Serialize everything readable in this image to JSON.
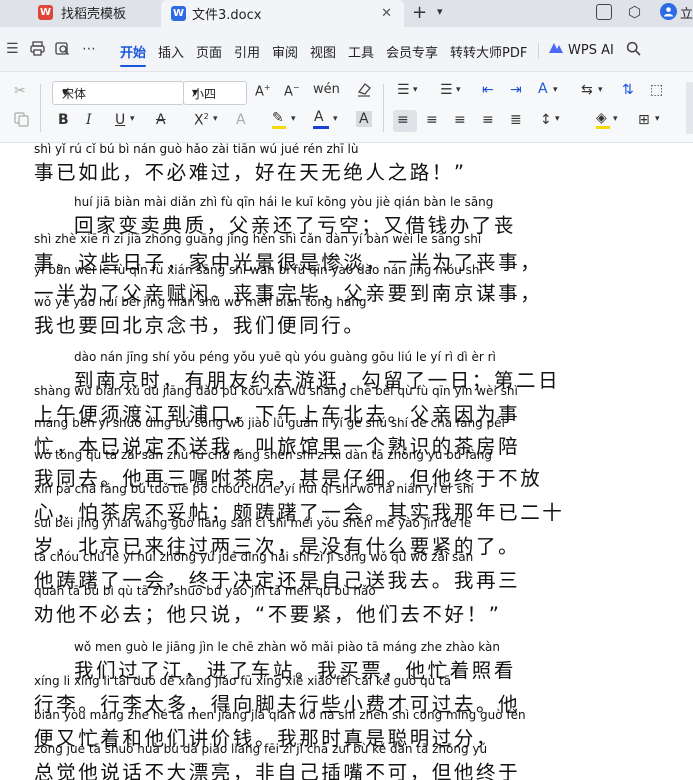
{
  "tabs": [
    {
      "label": "找稻壳模板"
    },
    {
      "label": "文件3.docx"
    }
  ],
  "tab_icons": {
    "wps": "W",
    "doc": "W"
  },
  "user": {
    "initial": "立",
    "name": "立"
  },
  "menu": {
    "items": [
      "开始",
      "插入",
      "页面",
      "引用",
      "审阅",
      "视图",
      "工具",
      "会员专享",
      "转转大师PDF"
    ],
    "wps_ai": "WPS AI"
  },
  "ribbon": {
    "font_name": "宋体",
    "font_size": "小四"
  },
  "document": {
    "lines": [
      {
        "py": "shì  yǐ  rú  cǐ    bú  bì  nán  guò     hǎo  zài  tiān  wú  jué  rén  zhī  lù",
        "hz": "事已如此，不必难过，好在天无绝人之路！”"
      },
      {
        "py": "huí  jiā  biàn  mài  diǎn  zhì    fù  qīn  hái  le  kuī  kōng    yòu  jiè  qián  bàn  le  sāng",
        "hz": "回家变卖典质，父亲还了亏空；又借钱办了丧",
        "indent": true
      },
      {
        "py": "shì    zhè  xiē  rì  zi     jiā  zhōng  guāng  jǐng  hěn  shì  cǎn  dàn     yí  bàn  wèi  le  sāng  shì",
        "hz": "事。这些日子，家中光景很是惨淡，一半为了丧事，"
      },
      {
        "py": "yí  bàn  wèi  le  fù  qīn  fù  xián    sāng  shì  wán  bì     fù  qīn  yào  dào  nán  jīng  móu  shì",
        "hz": "一半为了父亲赋闲。丧事完毕，父亲要到南京谋事，"
      },
      {
        "py": "wǒ  yě  yào  huí  běi  jīng  niàn  shū     wǒ  men  biàn  tóng  háng",
        "hz": "我也要回北京念书，我们便同行。"
      },
      {
        "py": "dào  nán  jīng  shí     yǒu  péng  yǒu  yuē  qù  yóu  guàng     gōu  liú  le  yí  rì     dì  èr  rì",
        "hz": "到南京时，有朋友约去游逛，勾留了一日；第二日",
        "indent": true
      },
      {
        "py": "shàng  wǔ  biàn  xū  dù  jiāng  dào  pǔ  kǒu     xià  wǔ  shàng  chē  běi  qù     fù  qīn  yīn  wèi  shì",
        "hz": "上午便须渡江到浦口，下午上车北去。父亲因为事"
      },
      {
        "py": "máng    běn  yǐ  shuō  dìng  bú  sòng  wǒ     jiào  lǚ  guǎn  lǐ  yí  gè  shú  shí  de  chá  fáng  péi",
        "hz": "忙，本已说定不送我，叫旅馆里一个熟识的茶房陪"
      },
      {
        "py": "wǒ  tóng  qù     tā  zài  sān  zhǔ  fù  chá  fáng     shèn  shì  zǐ  xì     dàn  tā  zhōng  yú  bú  fàng",
        "hz": "我同去。他再三嘱咐茶房，甚是仔细。但他终于不放"
      },
      {
        "py": "xīn     pà  chá  fáng  bú  tuǒ  tiē     pō  chóu  chú  le  yí  huì     qí  shí  wǒ  nà  nián  yǐ  èr  shí",
        "hz": "心，怕茶房不妥帖；颇踌躇了一会。其实我那年已二十"
      },
      {
        "py": "suì    běi  jīng  yǐ  lái  wǎng  guò  liǎng  sān  cì     shì  méi  yǒu  shén  me  yào  jǐn  de  le",
        "hz": "岁，北京已来往过两三次，是没有什么要紧的了。"
      },
      {
        "py": "tā  chóu  chú  le  yí  huì     zhōng  yú  jué  dìng  hái  shi  zì  jǐ  sòng  wǒ  qù     wǒ  zài  sān",
        "hz": "他踌躇了一会，终于决定还是自己送我去。我再三"
      },
      {
        "py": "quàn  tā  bú  bì  qù     tā  zhǐ  shuō     bú  yào  jǐn     tā  men  qù  bù  hǎo",
        "hz": "劝他不必去；他只说，“不要紧，他们去不好！”"
      },
      {
        "py": "wǒ  men  guò  le  jiāng     jìn  le  chē  zhàn     wǒ  mǎi  piào     tā  máng  zhe  zhào  kàn",
        "hz": "我们过了江，进了车站。我买票，他忙着照看",
        "indent": true
      },
      {
        "py": "xíng  li     xíng  li  tài  duō     dé  xiàng  jiǎo  fū  xíng  xiē  xiǎo  fèi  cái  kě  guò  qù     tā",
        "hz": "行李。行李太多，得向脚夫行些小费才可过去。他"
      },
      {
        "py": "biàn  yòu  máng  zhe  hé  tā  men  jiǎng  jià  qián     wǒ  nà  shí  zhēn  shì  cōng  míng  guò  fèn",
        "hz": "便又忙着和他们讲价钱。我那时真是聪明过分，"
      },
      {
        "py": "zǒng  jué  tā  shuō  huà  bú  dà  piào  liang     fēi  zì  jǐ  chā  zuǐ  bù  kě     dàn  tā  zhōng  yú",
        "hz": "总觉他说话不大漂亮，非自己插嘴不可，但他终于"
      }
    ]
  }
}
